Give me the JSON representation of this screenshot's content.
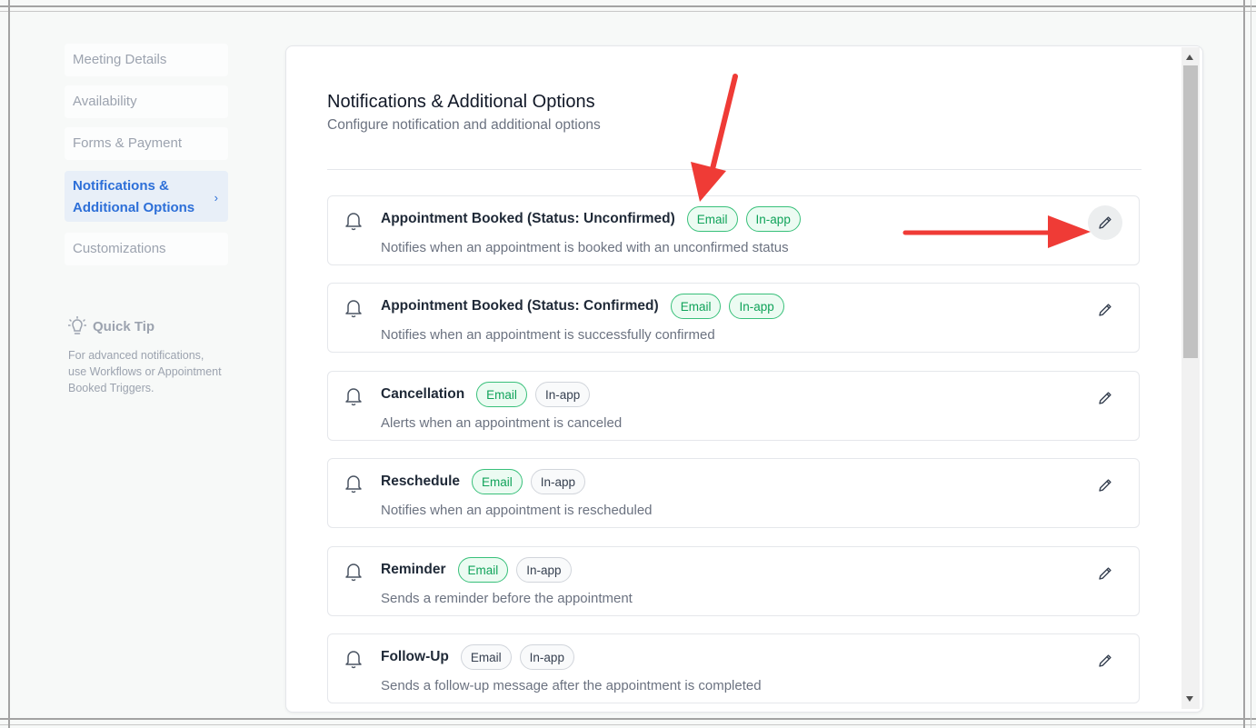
{
  "sidebar": {
    "items": [
      {
        "label": "Meeting Details",
        "active": false
      },
      {
        "label": "Availability",
        "active": false
      },
      {
        "label": "Forms & Payment",
        "active": false
      },
      {
        "label": "Notifications & Additional Options",
        "active": true
      },
      {
        "label": "Customizations",
        "active": false
      }
    ],
    "active_chevron": "›",
    "tip": {
      "title": "Quick Tip",
      "text": "For advanced notifications, use Workflows or Appointment Booked Triggers.",
      "icon": "lightbulb-icon"
    }
  },
  "main": {
    "title": "Notifications & Additional Options",
    "subtitle": "Configure notification and additional options",
    "notifications": [
      {
        "name": "Appointment Booked (Status: Unconfirmed)",
        "desc": "Notifies when an appointment is booked with an unconfirmed status",
        "email": "Email",
        "inapp": "In-app",
        "email_on": true,
        "inapp_on": true
      },
      {
        "name": "Appointment Booked (Status: Confirmed)",
        "desc": "Notifies when an appointment is successfully confirmed",
        "email": "Email",
        "inapp": "In-app",
        "email_on": true,
        "inapp_on": true
      },
      {
        "name": "Cancellation",
        "desc": "Alerts when an appointment is canceled",
        "email": "Email",
        "inapp": "In-app",
        "email_on": true,
        "inapp_on": false
      },
      {
        "name": "Reschedule",
        "desc": "Notifies when an appointment is rescheduled",
        "email": "Email",
        "inapp": "In-app",
        "email_on": true,
        "inapp_on": false
      },
      {
        "name": "Reminder",
        "desc": "Sends a reminder before the appointment",
        "email": "Email",
        "inapp": "In-app",
        "email_on": true,
        "inapp_on": false
      },
      {
        "name": "Follow-Up",
        "desc": "Sends a follow-up message after the appointment is completed",
        "email": "Email",
        "inapp": "In-app",
        "email_on": false,
        "inapp_on": false
      }
    ]
  },
  "colors": {
    "accent": "#2d6fd8",
    "badge_on": "#10a35a",
    "annotation_arrow": "#ef3b36"
  },
  "icons": {
    "row": "bell-icon",
    "edit": "pencil-icon"
  }
}
